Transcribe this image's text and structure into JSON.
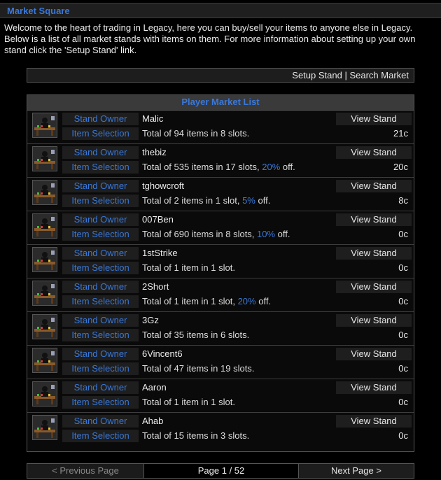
{
  "title": "Market Square",
  "intro": "Welcome to the heart of trading in Legacy, here you can buy/sell your items to anyone else in Legacy. Below is a list of all market stands with items on them. For more information about setting up your own stand click the 'Setup Stand' link.",
  "links": {
    "setup": "Setup Stand",
    "sep": " | ",
    "search": "Search Market"
  },
  "list": {
    "header": "Player Market List",
    "owner_label": "Stand Owner",
    "items_label": "Item Selection",
    "view_label": "View Stand",
    "rows": [
      {
        "owner": "Malic",
        "summary": "Total of 94 items in 8 slots.",
        "pct": "",
        "pct_suffix": "",
        "price": "21c",
        "icon": "market-stand-icon"
      },
      {
        "owner": "thebiz",
        "summary": "Total of 535 items in 17 slots, ",
        "pct": "20%",
        "pct_suffix": " off.",
        "price": "20c",
        "icon": "market-stand-icon"
      },
      {
        "owner": "tghowcroft",
        "summary": "Total of 2 items in 1 slot, ",
        "pct": "5%",
        "pct_suffix": " off.",
        "price": "8c",
        "icon": "market-stand-icon"
      },
      {
        "owner": "007Ben",
        "summary": "Total of 690 items in 8 slots, ",
        "pct": "10%",
        "pct_suffix": " off.",
        "price": "0c",
        "icon": "market-stand-icon"
      },
      {
        "owner": "1stStrike",
        "summary": "Total of 1 item in 1 slot.",
        "pct": "",
        "pct_suffix": "",
        "price": "0c",
        "icon": "market-stand-icon"
      },
      {
        "owner": "2Short",
        "summary": "Total of 1 item in 1 slot, ",
        "pct": "20%",
        "pct_suffix": " off.",
        "price": "0c",
        "icon": "market-stand-icon"
      },
      {
        "owner": "3Gz",
        "summary": "Total of 35 items in 6 slots.",
        "pct": "",
        "pct_suffix": "",
        "price": "0c",
        "icon": "market-stand-icon"
      },
      {
        "owner": "6Vincent6",
        "summary": "Total of 47 items in 19 slots.",
        "pct": "",
        "pct_suffix": "",
        "price": "0c",
        "icon": "market-stand-icon"
      },
      {
        "owner": "Aaron",
        "summary": "Total of 1 item in 1 slot.",
        "pct": "",
        "pct_suffix": "",
        "price": "0c",
        "icon": "market-stand-icon"
      },
      {
        "owner": "Ahab",
        "summary": "Total of 15 items in 3 slots.",
        "pct": "",
        "pct_suffix": "",
        "price": "0c",
        "icon": "market-stand-icon"
      }
    ]
  },
  "pager": {
    "prev": "< Previous Page",
    "page": "Page 1 / 52",
    "next": "Next Page >"
  },
  "colors": {
    "accent": "#3a78d8",
    "background": "#000000",
    "panel": "#1e1e1e"
  }
}
